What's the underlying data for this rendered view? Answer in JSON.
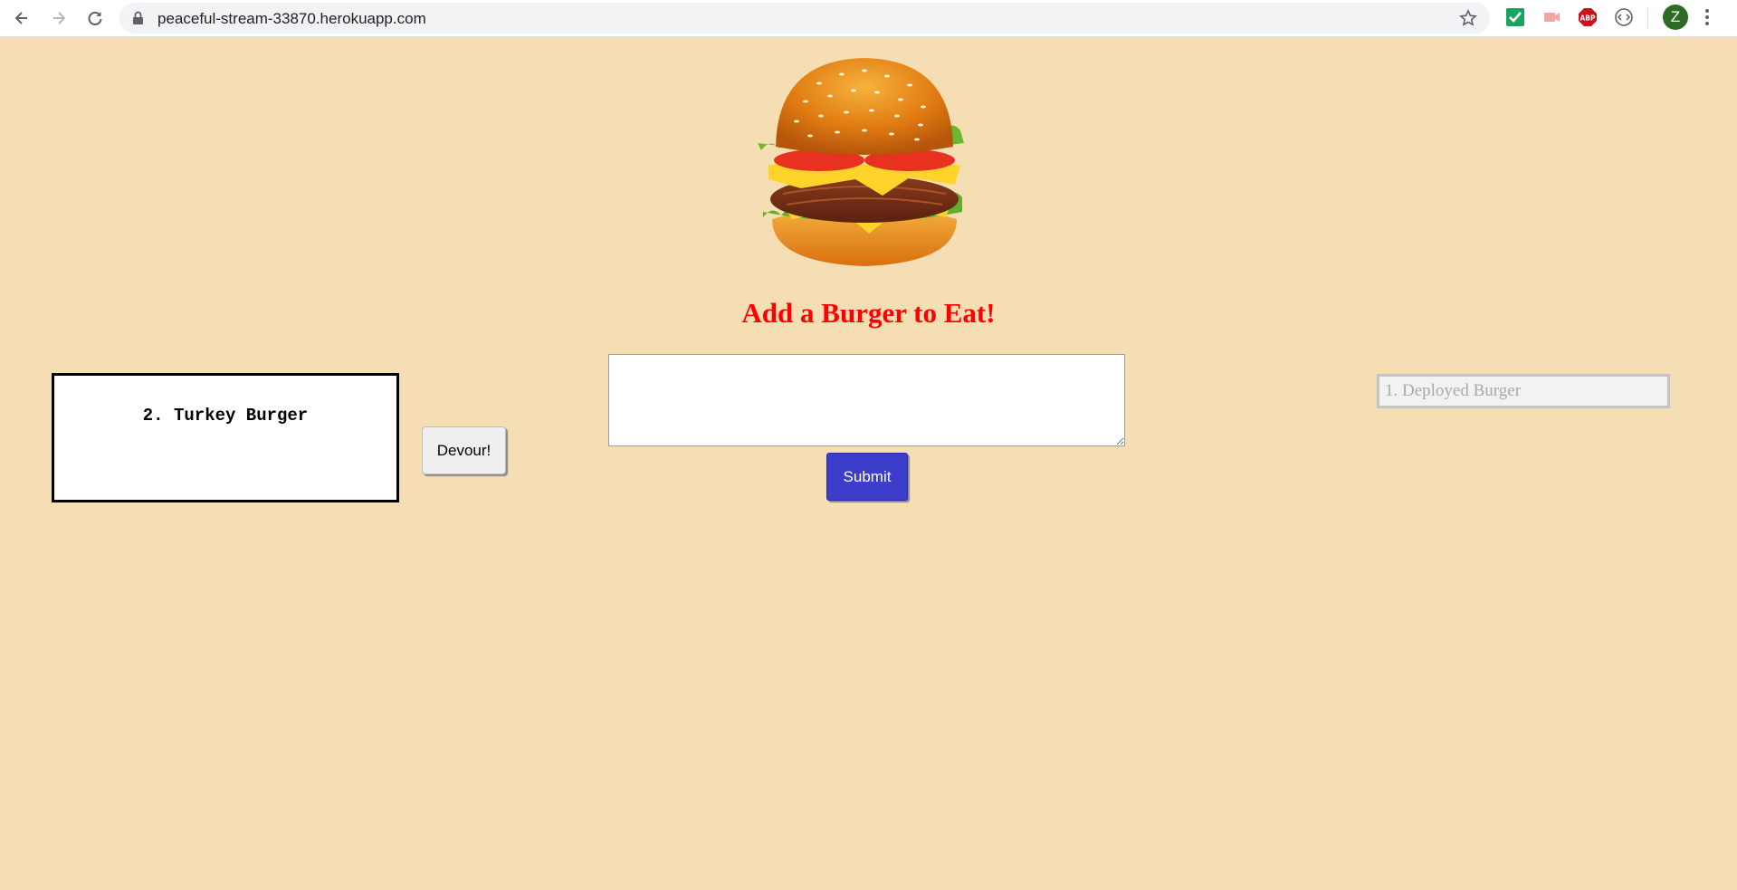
{
  "browser": {
    "url": "peaceful-stream-33870.herokuapp.com",
    "profile_initial": "Z",
    "icons": [
      "back-arrow-icon",
      "forward-arrow-icon",
      "reload-icon",
      "lock-icon",
      "star-icon",
      "checkmark-extension-icon",
      "cast-extension-icon",
      "adblock-extension-icon",
      "code-extension-icon",
      "menu-dots-icon"
    ],
    "colors": {
      "profile": "#2e6b23",
      "adblock": "#c4161c",
      "checkmark": "#1aa260"
    }
  },
  "page": {
    "title": "Add a Burger to Eat!",
    "background_color": "#f5deb3",
    "title_color": "#ff0000",
    "burger_image": "burger-icon",
    "uneaten": [
      {
        "label": "2. Turkey Burger",
        "button": "Devour!"
      }
    ],
    "form": {
      "input_value": "",
      "submit_label": "Submit",
      "submit_color": "#3d3dcc"
    },
    "devoured": [
      {
        "label": "1. Deployed Burger"
      }
    ]
  }
}
